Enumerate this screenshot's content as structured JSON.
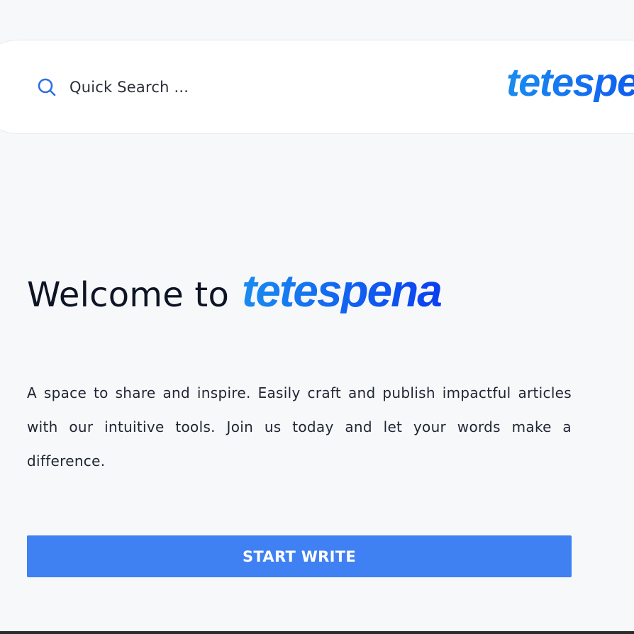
{
  "header": {
    "search": {
      "icon": "search-icon",
      "placeholder": "Quick Search ..."
    },
    "logo_text": "tetespena"
  },
  "hero": {
    "welcome_text": "Welcome to",
    "brand_text": "tetespena",
    "description": "A space to share and inspire. Easily craft and publish impactful articles with our intuitive tools. Join us today and let your words make a difference.",
    "cta_label": "START WRITE"
  },
  "colors": {
    "background": "#f7f8fa",
    "brand_gradient_start": "#1a8cf0",
    "brand_gradient_end": "#0b3ff0",
    "button": "#3f80f3",
    "search_icon": "#2f6fe0"
  }
}
